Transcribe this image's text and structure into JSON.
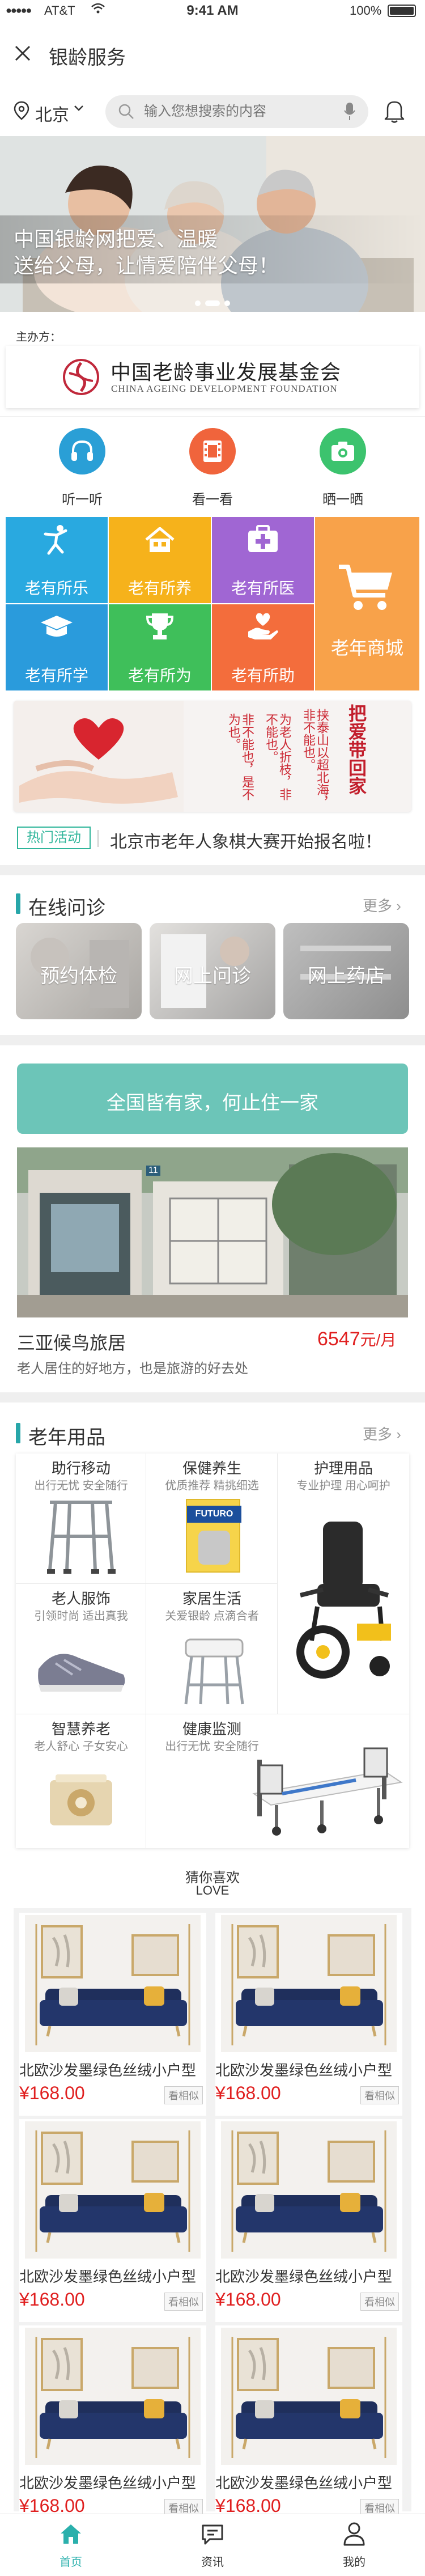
{
  "status_bar": {
    "carrier": "AT&T",
    "time": "9:41 AM",
    "battery": "100%"
  },
  "nav": {
    "title": "银龄服务"
  },
  "search": {
    "city": "北京",
    "placeholder": "输入您想搜索的内容"
  },
  "banner": {
    "line1": "中国银龄网把爱、温暖",
    "line2": "送给父母，让情爱陪伴父母！"
  },
  "sponsor": {
    "label": "主办方：",
    "org_cn": "中国老龄事业发展基金会",
    "org_en": "CHINA AGEING DEVELOPMENT FOUNDATION"
  },
  "quick_actions": [
    {
      "label": "听一听",
      "icon": "headphones-icon",
      "color": "#2a9fd6"
    },
    {
      "label": "看一看",
      "icon": "film-icon",
      "color": "#f0643c"
    },
    {
      "label": "晒一晒",
      "icon": "camera-icon",
      "color": "#3cc36e"
    }
  ],
  "services": [
    {
      "label": "老有所乐",
      "color": "#29a9e0",
      "icon": "dancer-icon"
    },
    {
      "label": "老有所养",
      "color": "#f6b21b",
      "icon": "house-icon"
    },
    {
      "label": "老有所医",
      "color": "#a066d3",
      "icon": "medical-kit-icon"
    },
    {
      "label": "老有所学",
      "color": "#2a9bdc",
      "icon": "graduation-cap-icon"
    },
    {
      "label": "老有所为",
      "color": "#3fbf5a",
      "icon": "trophy-icon"
    },
    {
      "label": "老有所助",
      "color": "#f36d3c",
      "icon": "helping-hand-icon"
    }
  ],
  "mall": {
    "label": "老年商城",
    "color": "#f8a24a"
  },
  "charity_banner": {
    "title": "把爱带回家",
    "verse1": "非不能也，是不为也。",
    "verse2": "为老人折枝，非不能也。",
    "verse3": "挟泰山以超北海，非不能也。"
  },
  "news": {
    "tag": "热门活动",
    "text": "北京市老年人象棋大赛开始报名啦！"
  },
  "consult": {
    "title": "在线问诊",
    "more": "更多",
    "items": [
      "预约体检",
      "网上问诊",
      "网上药店"
    ]
  },
  "slogan": "全国皆有家，何止住一家",
  "hostel": {
    "name": "三亚候鸟旅居",
    "price": "6547",
    "unit": "元/月",
    "desc": "老人居住的好地方，也是旅游的好去处",
    "door_number": "11"
  },
  "supplies": {
    "title": "老年用品",
    "more": "更多",
    "cells": [
      {
        "title": "助行移动",
        "sub": "出行无忧 安全随行"
      },
      {
        "title": "保健养生",
        "sub": "优质推荐 精挑细选"
      },
      {
        "title": "护理用品",
        "sub": "专业护理 用心呵护"
      },
      {
        "title": "老人服饰",
        "sub": "引领时尚 适出真我"
      },
      {
        "title": "家居生活",
        "sub": "关爱银龄 点滴合者"
      },
      {
        "title": "智慧养老",
        "sub": "老人舒心 子女安心"
      },
      {
        "title": "健康监测",
        "sub": "出行无忧 安全随行"
      }
    ],
    "product_brand": "FUTURO"
  },
  "recommend": {
    "title": "猜你喜欢",
    "subtitle": "LOVE"
  },
  "products": [
    {
      "name": "北欧沙发墨绿色丝绒小户型",
      "price": "¥168.00",
      "tag": "看相似"
    },
    {
      "name": "北欧沙发墨绿色丝绒小户型",
      "price": "¥168.00",
      "tag": "看相似"
    },
    {
      "name": "北欧沙发墨绿色丝绒小户型",
      "price": "¥168.00",
      "tag": "看相似"
    },
    {
      "name": "北欧沙发墨绿色丝绒小户型",
      "price": "¥168.00",
      "tag": "看相似"
    },
    {
      "name": "北欧沙发墨绿色丝绒小户型",
      "price": "¥168.00",
      "tag": "看相似"
    },
    {
      "name": "北欧沙发墨绿色丝绒小户型",
      "price": "¥168.00",
      "tag": "看相似"
    }
  ],
  "tabbar": [
    {
      "label": "首页",
      "icon": "home-icon",
      "active": true
    },
    {
      "label": "资讯",
      "icon": "chat-icon",
      "active": false
    },
    {
      "label": "我的",
      "icon": "user-icon",
      "active": false
    }
  ],
  "colors": {
    "accent": "#27a6a9",
    "price": "#e02020",
    "news_tag": "#2fb59a",
    "slogan_bg": "#6cc5b8"
  }
}
